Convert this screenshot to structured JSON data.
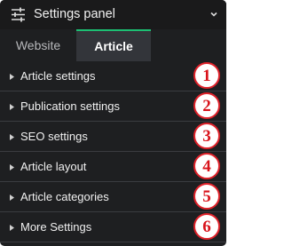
{
  "header": {
    "title": "Settings panel",
    "icon": "sliders-icon",
    "toggle_icon": "chevron-down-icon"
  },
  "tabs": [
    {
      "label": "Website",
      "active": false
    },
    {
      "label": "Article",
      "active": true
    }
  ],
  "sections": [
    {
      "label": "Article settings",
      "badge": "1"
    },
    {
      "label": "Publication settings",
      "badge": "2"
    },
    {
      "label": "SEO settings",
      "badge": "3"
    },
    {
      "label": "Article layout",
      "badge": "4"
    },
    {
      "label": "Article categories",
      "badge": "5"
    },
    {
      "label": "More Settings",
      "badge": "6"
    }
  ],
  "colors": {
    "panel_background": "#1e1f21",
    "active_tab_background": "#33353a",
    "active_tab_accent": "#1dbf73",
    "badge_ring": "#e0222a",
    "badge_text": "#d8131b"
  }
}
